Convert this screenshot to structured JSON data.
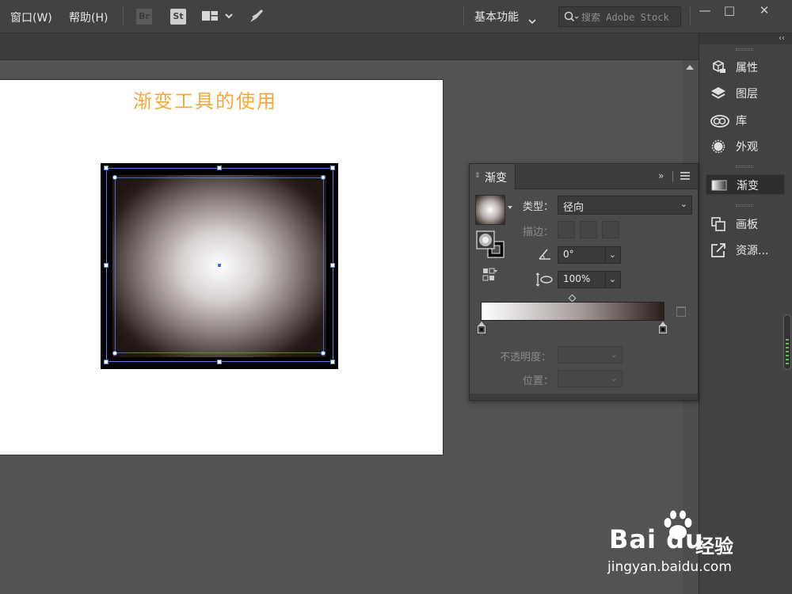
{
  "menubar": {
    "items": [
      "窗口(W)",
      "帮助(H)"
    ],
    "app_icons": [
      "Br",
      "St"
    ],
    "workspace": "基本功能",
    "search_placeholder": "搜索 Adobe Stock",
    "window_controls": [
      "—",
      "□",
      "✕"
    ]
  },
  "artboard": {
    "title": "渐变工具的使用"
  },
  "dock": {
    "items": [
      {
        "label": "属性",
        "icon": "properties-icon"
      },
      {
        "label": "图层",
        "icon": "layers-icon"
      },
      {
        "label": "库",
        "icon": "libraries-icon"
      },
      {
        "label": "外观",
        "icon": "appearance-icon"
      },
      {
        "label": "渐变",
        "icon": "gradient-icon"
      },
      {
        "label": "画板",
        "icon": "artboards-icon"
      },
      {
        "label": "资源...",
        "icon": "assets-icon"
      }
    ],
    "active": "渐变"
  },
  "gradient_panel": {
    "tab_label": "渐变",
    "type_label": "类型：",
    "type_value": "径向",
    "stroke_label": "描边：",
    "angle_value": "0°",
    "aspect_value": "100%",
    "opacity_label": "不透明度：",
    "location_label": "位置："
  },
  "watermark": {
    "brand": "Bai du",
    "suffix": "经验",
    "url": "jingyan.baidu.com"
  }
}
